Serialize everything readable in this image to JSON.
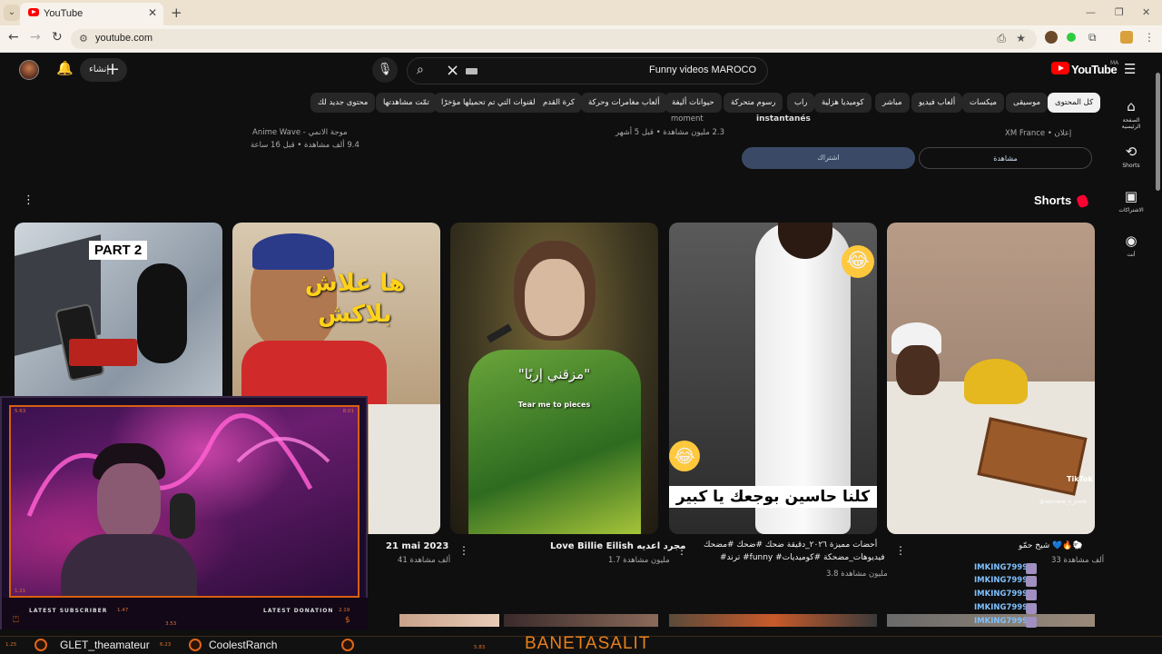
{
  "browser": {
    "tab_title": "YouTube",
    "url": "youtube.com",
    "new_tab_glyph": "+",
    "close_glyph": "✕"
  },
  "masthead": {
    "create_label": "إنشاء",
    "search_query": "Funny videos  MAROCO",
    "logo_text": "YouTube",
    "region": "MA"
  },
  "chips": [
    {
      "label": "كل المحتوى",
      "active": true
    },
    {
      "label": "موسيقى"
    },
    {
      "label": "ميكسات"
    },
    {
      "label": "ألعاب فيديو"
    },
    {
      "label": "مباشر"
    },
    {
      "label": "كوميديا هزلية"
    },
    {
      "label": "راب"
    },
    {
      "label": "رسوم متحركة"
    },
    {
      "label": "حيوانات أليفة"
    },
    {
      "label": "ألعاب مغامرات وحركة"
    },
    {
      "label": "كرة القدم"
    },
    {
      "label": "القنوات التي تم تحميلها مؤخرًا"
    },
    {
      "label": "تمّت مشاهدتها"
    },
    {
      "label": "محتوى جديد لك"
    }
  ],
  "guide": [
    {
      "label": "الصفحة الرئيسية",
      "icon": "home-icon"
    },
    {
      "label": "Shorts",
      "icon": "shorts-icon"
    },
    {
      "label": "الاشتراكات",
      "icon": "subscriptions-icon"
    },
    {
      "label": "أنت",
      "icon": "you-icon"
    }
  ],
  "prev_row": {
    "v1_channel": "موجة الانمي - Anime Wave",
    "v1_stats": "9.4 ألف مشاهدة • قبل 16 ساعة",
    "v2_title": "moment",
    "v2_stats": "2.3 مليون مشاهدة • قبل 5 أشهر",
    "v3_title": "instantanés",
    "v3_channel": "إعلان • XM France",
    "subscribe_label": "اشتراك",
    "watch_label": "مشاهدة"
  },
  "shorts": {
    "title": "Shorts",
    "items": [
      {
        "caption": "21 mai 2023",
        "views": "41 ألف مشاهدة",
        "overlay": "PART 2"
      },
      {
        "caption": "",
        "views": "",
        "overlay": "ها علاش بلاكش"
      },
      {
        "caption": "Love Billie Eilish مجرد اعديه",
        "views": "1.7 مليون مشاهدة",
        "overlay": "\"مزقني إربًا\"",
        "overlay2": "Tear me to pieces"
      },
      {
        "caption": "أحضات مميزة ٢٠٢٦_دقيقة ضحك #ضحك #مضحك",
        "caption2": "#ترند #funny #فيديوهات_مضحكة #كوميديات",
        "views": "3.8 مليون مشاهدة",
        "overlay": "كلنا حاسين بوجعك يا كبير"
      },
      {
        "caption": "شيخ حمّو 💙🔥🐑",
        "views": "33 ألف مشاهدة",
        "overlay": "TikTok",
        "overlay2": "@lakmane_h_youb"
      }
    ]
  },
  "stream": {
    "latest_subscriber_label": "LATEST SUBSCRIBER",
    "latest_donation_label": "LATEST DONATION",
    "subscriber_name": "GLET_theamateur",
    "donor_name": "CoolestRanch",
    "banner": "BANETASALIT",
    "cam_numbers": [
      "5.63",
      "8.01",
      "1.21",
      "1.47",
      "2.19",
      "3.53",
      "1.25",
      "6.23",
      "5.83"
    ]
  },
  "chat": [
    "IMKING7999",
    "IMKING7999",
    "IMKING7999",
    "IMKING7999",
    "IMKING7999"
  ],
  "colors": {
    "brand": "#ff0000",
    "overlay_accent": "#e0661a",
    "chat_name": "#7ec0ff"
  }
}
